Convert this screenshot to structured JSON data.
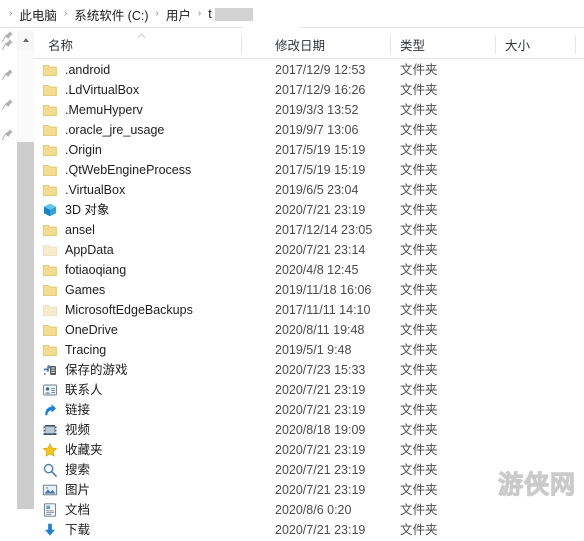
{
  "breadcrumb": {
    "separator": "›",
    "items": [
      {
        "label": "此电脑",
        "redacted": false
      },
      {
        "label": "系统软件 (C:)",
        "redacted": false
      },
      {
        "label": "用户",
        "redacted": false
      },
      {
        "label": "t",
        "redacted": true
      }
    ]
  },
  "columns": {
    "name": "名称",
    "date_modified": "修改日期",
    "type": "类型",
    "size": "大小",
    "sort_icon": "sort-ascending-icon"
  },
  "scrollbar": {
    "up_arrow": "chevron-up-icon"
  },
  "folder_type_label": "文件夹",
  "rows": [
    {
      "name": ".android",
      "icon": "folder-icon",
      "dim": false,
      "date": "2017/12/9 12:53",
      "type": "文件夹",
      "size": ""
    },
    {
      "name": ".LdVirtualBox",
      "icon": "folder-icon",
      "dim": false,
      "date": "2017/12/9 16:26",
      "type": "文件夹",
      "size": ""
    },
    {
      "name": ".MemuHyperv",
      "icon": "folder-icon",
      "dim": false,
      "date": "2019/3/3 13:52",
      "type": "文件夹",
      "size": ""
    },
    {
      "name": ".oracle_jre_usage",
      "icon": "folder-icon",
      "dim": false,
      "date": "2019/9/7 13:06",
      "type": "文件夹",
      "size": ""
    },
    {
      "name": ".Origin",
      "icon": "folder-icon",
      "dim": false,
      "date": "2017/5/19 15:19",
      "type": "文件夹",
      "size": ""
    },
    {
      "name": ".QtWebEngineProcess",
      "icon": "folder-icon",
      "dim": false,
      "date": "2017/5/19 15:19",
      "type": "文件夹",
      "size": ""
    },
    {
      "name": ".VirtualBox",
      "icon": "folder-icon",
      "dim": false,
      "date": "2019/6/5 23:04",
      "type": "文件夹",
      "size": ""
    },
    {
      "name": "3D 对象",
      "icon": "3d-objects-icon",
      "dim": false,
      "date": "2020/7/21 23:19",
      "type": "文件夹",
      "size": ""
    },
    {
      "name": "ansel",
      "icon": "folder-icon",
      "dim": false,
      "date": "2017/12/14 23:05",
      "type": "文件夹",
      "size": ""
    },
    {
      "name": "AppData",
      "icon": "folder-icon-faded",
      "dim": false,
      "date": "2020/7/21 23:14",
      "type": "文件夹",
      "size": ""
    },
    {
      "name": "fotiaoqiang",
      "icon": "folder-icon",
      "dim": false,
      "date": "2020/4/8 12:45",
      "type": "文件夹",
      "size": ""
    },
    {
      "name": "Games",
      "icon": "folder-icon",
      "dim": false,
      "date": "2019/11/18 16:06",
      "type": "文件夹",
      "size": ""
    },
    {
      "name": "MicrosoftEdgeBackups",
      "icon": "folder-icon-faded",
      "dim": false,
      "date": "2017/11/11 14:10",
      "type": "文件夹",
      "size": ""
    },
    {
      "name": "OneDrive",
      "icon": "folder-icon",
      "dim": false,
      "date": "2020/8/11 19:48",
      "type": "文件夹",
      "size": ""
    },
    {
      "name": "Tracing",
      "icon": "folder-icon",
      "dim": false,
      "date": "2019/5/1 9:48",
      "type": "文件夹",
      "size": ""
    },
    {
      "name": "保存的游戏",
      "icon": "saved-games-icon",
      "dim": false,
      "date": "2020/7/23 15:33",
      "type": "文件夹",
      "size": ""
    },
    {
      "name": "联系人",
      "icon": "contacts-icon",
      "dim": false,
      "date": "2020/7/21 23:19",
      "type": "文件夹",
      "size": ""
    },
    {
      "name": "链接",
      "icon": "links-icon",
      "dim": false,
      "date": "2020/7/21 23:19",
      "type": "文件夹",
      "size": ""
    },
    {
      "name": "视频",
      "icon": "videos-icon",
      "dim": false,
      "date": "2020/8/18 19:09",
      "type": "文件夹",
      "size": ""
    },
    {
      "name": "收藏夹",
      "icon": "favorites-icon",
      "dim": false,
      "date": "2020/7/21 23:19",
      "type": "文件夹",
      "size": ""
    },
    {
      "name": "搜索",
      "icon": "searches-icon",
      "dim": false,
      "date": "2020/7/21 23:19",
      "type": "文件夹",
      "size": ""
    },
    {
      "name": "图片",
      "icon": "pictures-icon",
      "dim": false,
      "date": "2020/7/21 23:19",
      "type": "文件夹",
      "size": ""
    },
    {
      "name": "文档",
      "icon": "documents-icon",
      "dim": false,
      "date": "2020/8/6 0:20",
      "type": "文件夹",
      "size": ""
    },
    {
      "name": "下载",
      "icon": "downloads-icon",
      "dim": false,
      "date": "2020/7/21 23:19",
      "type": "文件夹",
      "size": ""
    }
  ],
  "watermark": {
    "text": "游侠网"
  },
  "colors": {
    "folder_yellow": "#f5dc8f",
    "folder_yellow_faded": "#f6eccb",
    "accent_blue": "#1a7fd4",
    "star_yellow": "#f5c521",
    "header_text": "#30343a",
    "row_text": "#1d1d1d",
    "date_text": "#4a4a4a",
    "scrollbar_thumb": "#cdcdcd"
  }
}
